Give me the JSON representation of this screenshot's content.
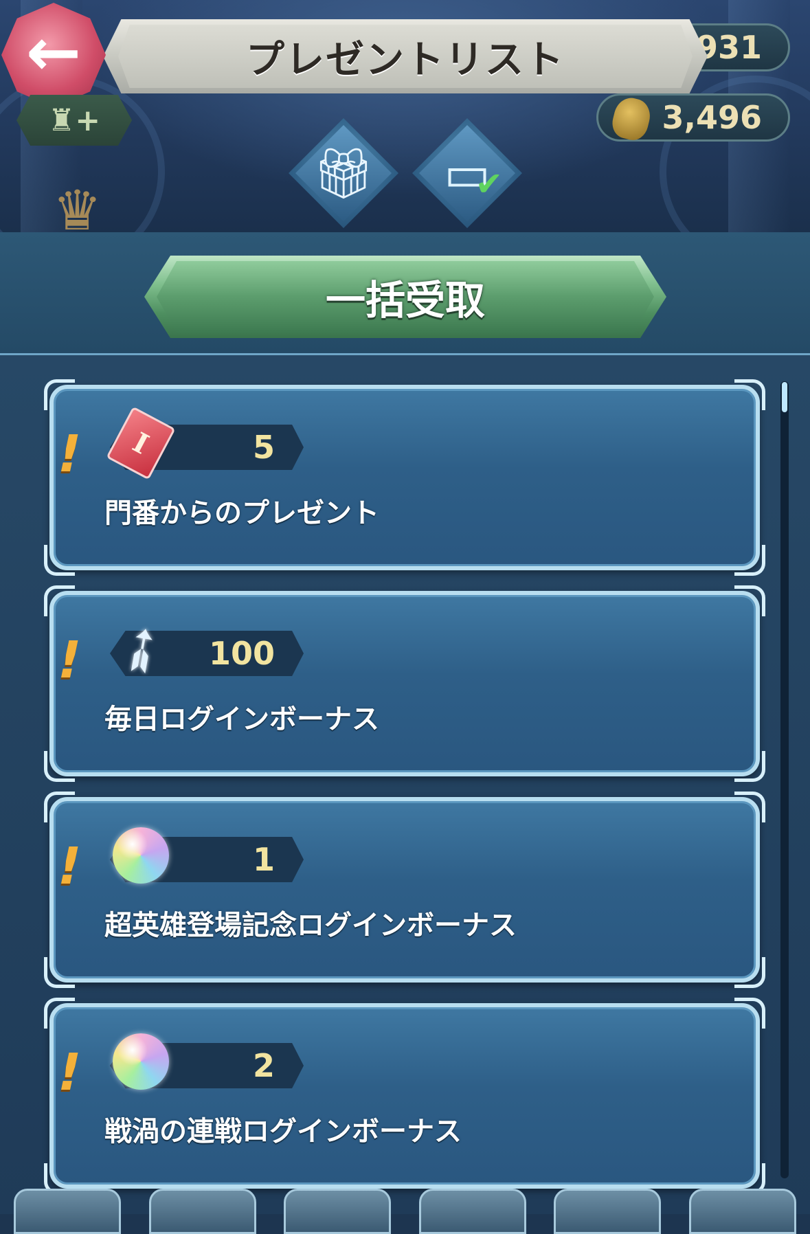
{
  "header": {
    "title": "プレゼントリスト",
    "orb_count": "931",
    "feather_count": "3,496"
  },
  "tabs": [
    {
      "label": "gift-icon",
      "active": true
    },
    {
      "label": "checklist-icon",
      "active": false
    }
  ],
  "collect_all": {
    "label": "一括受取"
  },
  "presents": [
    {
      "icon": "ticket-icon",
      "quantity": "5",
      "caption": "門番からのプレゼント"
    },
    {
      "icon": "feather-icon",
      "quantity": "100",
      "caption": "毎日ログインボーナス"
    },
    {
      "icon": "orb-icon",
      "quantity": "1",
      "caption": "超英雄登場記念ログインボーナス"
    },
    {
      "icon": "orb-icon",
      "quantity": "2",
      "caption": "戦渦の連戦ログインボーナス"
    }
  ],
  "colors": {
    "accent_green": "#5c9d6d",
    "card_blue": "#2e5f88",
    "quantity_text": "#f2e4a0",
    "alert": "#f4b13a"
  }
}
